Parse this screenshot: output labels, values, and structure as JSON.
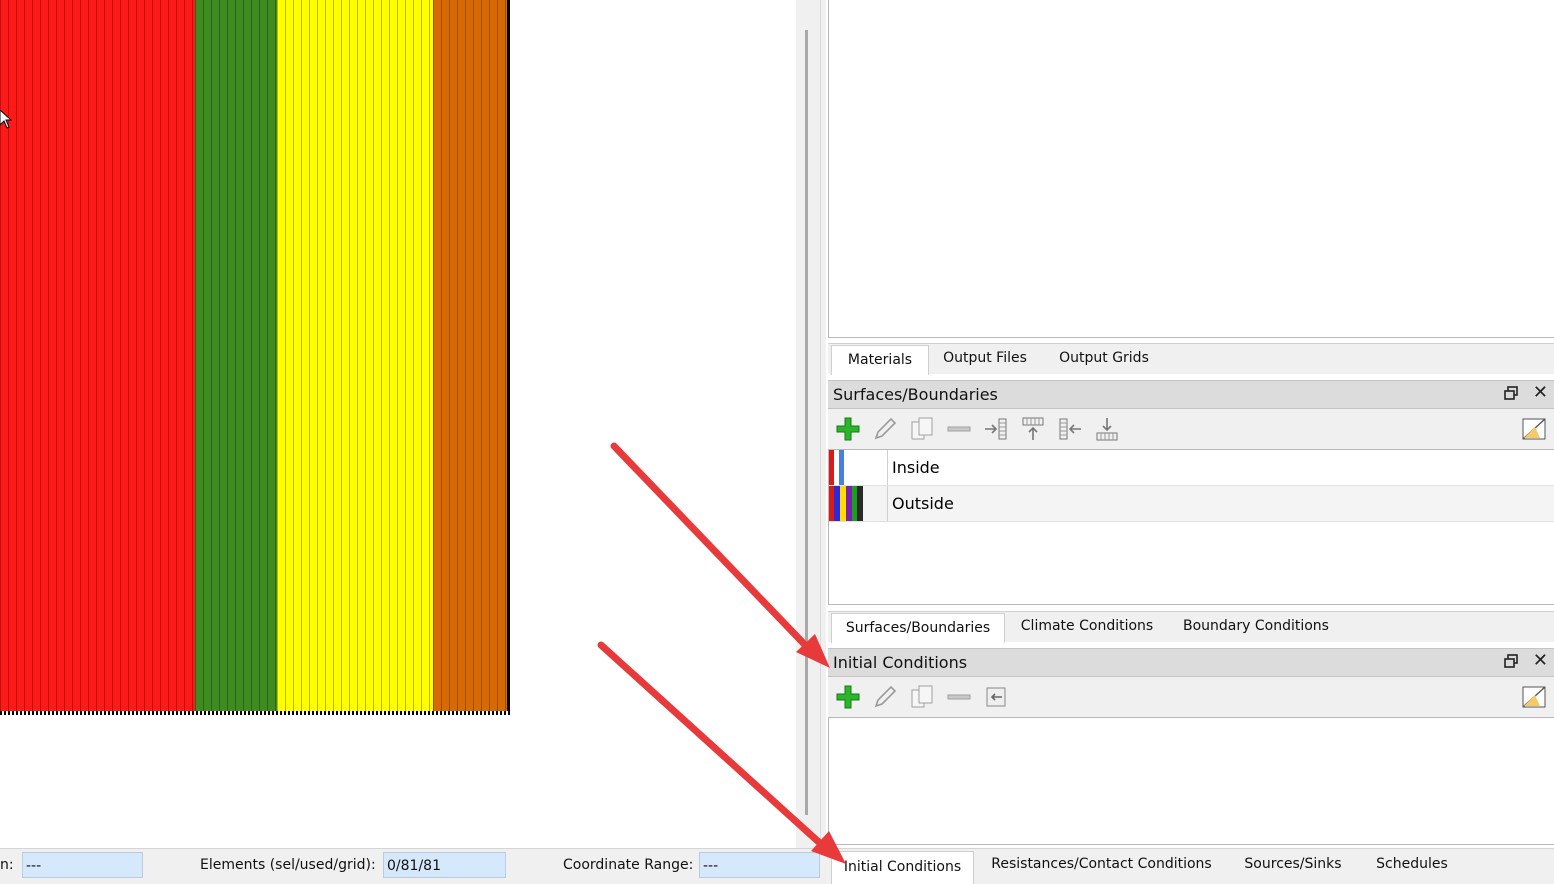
{
  "canvas": {
    "bands": [
      {
        "name": "red",
        "color": "#ff1a1a"
      },
      {
        "name": "green",
        "color": "#3e8c1f"
      },
      {
        "name": "yellow",
        "color": "#ffff00"
      },
      {
        "name": "orange",
        "color": "#d86a06"
      }
    ]
  },
  "top_tabs": {
    "items": [
      "Materials",
      "Output Files",
      "Output Grids"
    ],
    "active": "Materials"
  },
  "surfaces_panel": {
    "title": "Surfaces/Boundaries",
    "toolbar_icons": [
      "add-icon",
      "edit-icon",
      "copy-icon",
      "remove-icon",
      "assign-right-icon",
      "assign-top-icon",
      "assign-left-icon",
      "assign-bottom-icon"
    ],
    "rows": [
      {
        "label": "Inside",
        "colors": [
          "#d81b1b",
          "#ffffff",
          "#4a7fe0"
        ]
      },
      {
        "label": "Outside",
        "colors": [
          "#d81b1b",
          "#2a2ad8",
          "#ffdd00",
          "#7a1fb0",
          "#1aa01a"
        ]
      }
    ]
  },
  "middle_tabs": {
    "items": [
      "Surfaces/Boundaries",
      "Climate Conditions",
      "Boundary Conditions"
    ],
    "active": "Surfaces/Boundaries"
  },
  "initial_panel": {
    "title": "Initial Conditions",
    "toolbar_icons": [
      "add-icon",
      "edit-icon",
      "copy-icon",
      "remove-icon",
      "assign-icon"
    ]
  },
  "bottom_tabs": {
    "items": [
      "Initial Conditions",
      "Resistances/Contact Conditions",
      "Sources/Sinks",
      "Schedules"
    ],
    "active": "Initial Conditions"
  },
  "status_bar": {
    "first_label": "n:",
    "first_value": "---",
    "elements_label": "Elements (sel/used/grid):",
    "elements_value": "0/81/81",
    "coord_label": "Coordinate Range:",
    "coord_value": "---"
  },
  "annotations": {
    "arrow_color": "#e8393b"
  }
}
